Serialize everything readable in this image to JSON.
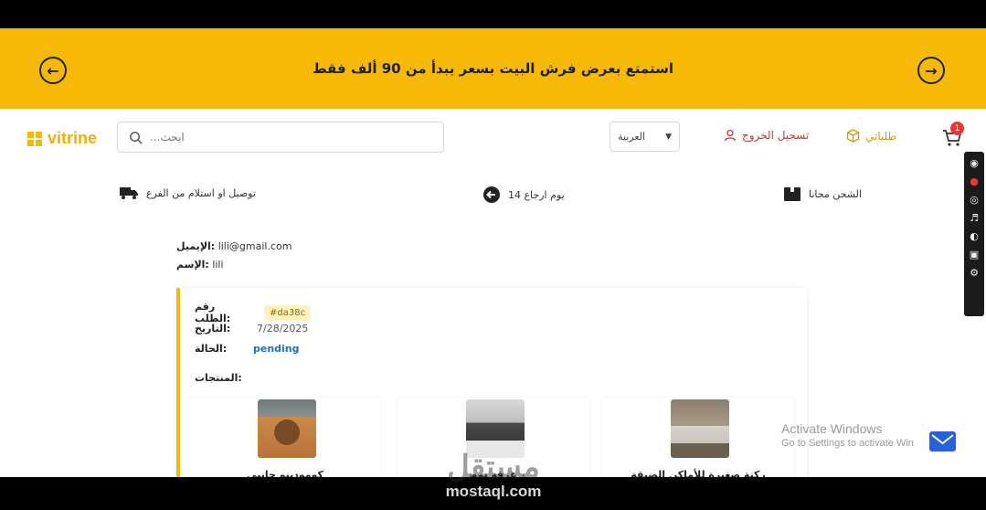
{
  "promo": {
    "text": "استمتع بعرض فرش البيت بسعر يبدأ من 90 ألف فقط",
    "prev_icon": "arrow-left-circle",
    "next_icon": "arrow-right-circle"
  },
  "header": {
    "brand": "vitrine",
    "search_placeholder": "ابحث...",
    "language": "العربية",
    "logout": "تسجيل الخروج",
    "orders": "طلباتي",
    "cart_count": "1"
  },
  "features": [
    {
      "label": "توصيل او استلام من الفرع",
      "icon": "truck-icon"
    },
    {
      "label": "يوم ارجاع 14",
      "icon": "return-arrow-icon"
    },
    {
      "label": "الشحن مجانا",
      "icon": "box-icon"
    }
  ],
  "user": {
    "email_label": "الإيميل:",
    "email": "lili@gmail.com",
    "name_label": "الإسم:",
    "name": "lili"
  },
  "order": {
    "id_label": "رقم الطلب:",
    "id": "#da38c",
    "date_label": "التاريخ:",
    "date": "7/28/2025",
    "status_label": "الحالة:",
    "status": "pending",
    "products_label": "المنتجات:",
    "products": [
      {
        "name": "ركنة صغيرة للأماكن الضيقة",
        "image": "sofa-photo"
      },
      {
        "name": "غرفة نوم",
        "image": "bedroom-photo"
      },
      {
        "name": "كومودينو جانبي",
        "image": "nightstand-photo"
      }
    ]
  },
  "overlay": {
    "activate_title": "Activate Windows",
    "activate_sub": "Go to Settings to activate Win",
    "watermark_logo": "مستقل",
    "watermark_url": "mostaql.com"
  },
  "colors": {
    "accent": "#f7b908",
    "logout": "#d32f2f",
    "status": "#1e6fc8"
  }
}
